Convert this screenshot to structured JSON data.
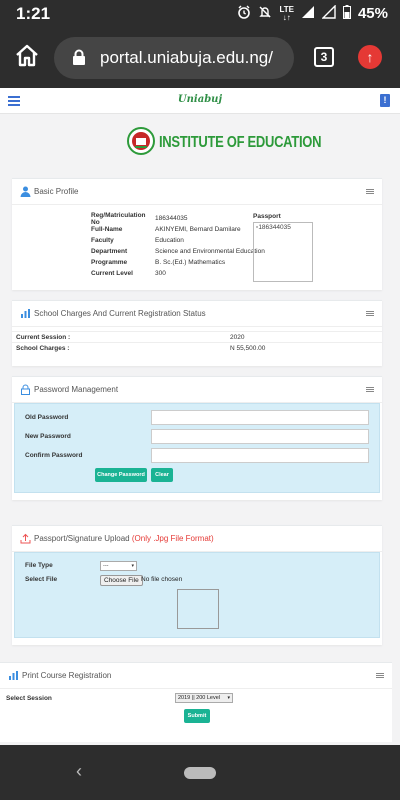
{
  "status_bar": {
    "time": "1:21",
    "network": "LTE",
    "battery": "45%"
  },
  "browser": {
    "url": "portal.uniabuja.edu.ng/",
    "tab_count": "3"
  },
  "site": {
    "brand": "Uniabuj",
    "institute": "INSTITUTE OF EDUCATION"
  },
  "basic_profile": {
    "title": "Basic Profile",
    "fields": [
      {
        "label": "Reg/Matriculation No",
        "value": "186344035"
      },
      {
        "label": "Full-Name",
        "value": "AKINYEMI, Bernard Damilare"
      },
      {
        "label": "Faculty",
        "value": "Education"
      },
      {
        "label": "Department",
        "value": "Science and Environmental Education"
      },
      {
        "label": "Programme",
        "value": "B. Sc.(Ed.) Mathematics"
      },
      {
        "label": "Current Level",
        "value": "300"
      }
    ],
    "passport_label": "Passport",
    "passport_alt": "186344035"
  },
  "charges": {
    "title": "School Charges And Current Registration Status",
    "rows": [
      {
        "label": "Current Session :",
        "value": "2020"
      },
      {
        "label": "School Charges :",
        "value": "N 55,500.00"
      }
    ]
  },
  "password": {
    "title": "Password Management",
    "old_label": "Old Password",
    "new_label": "New Password",
    "confirm_label": "Confirm Password",
    "change_button": "Change Password",
    "clear_button": "Clear"
  },
  "upload": {
    "title": "Passport/Signature Upload",
    "note": "(Only .Jpg File Format)",
    "file_type_label": "File Type",
    "file_type_value": "---",
    "select_file_label": "Select File",
    "choose_file_button": "Choose File",
    "no_file_text": "No file chosen"
  },
  "course_registration": {
    "title": "Print Course Registration",
    "session_label": "Select Session",
    "session_value": "2019 || 200 Level",
    "submit_button": "Submit"
  },
  "colors": {
    "accent": "#1ab394",
    "link_blue": "#3b6fd1",
    "panel_bg": "#d6eef8",
    "warning_red": "#e53935"
  }
}
